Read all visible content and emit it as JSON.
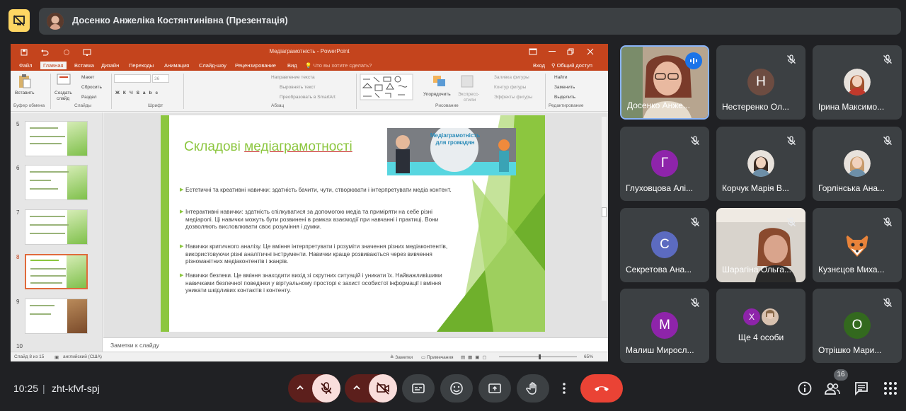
{
  "meeting": {
    "presenter_banner": "Досенко Анжеліка Костянтинівна (Презентація)",
    "time": "10:25",
    "separator": "|",
    "meeting_code": "zht-kfvf-spj",
    "participants_count": "16"
  },
  "powerpoint": {
    "window_title": "Медіаграмотність - PowerPoint",
    "tabs": [
      "Файл",
      "Главная",
      "Вставка",
      "Дизайн",
      "Переходы",
      "Анимация",
      "Слайд-шоу",
      "Рецензирование",
      "Вид"
    ],
    "tell_me": "Что вы хотите сделать?",
    "sign_in": "Вход",
    "share": "Общий доступ",
    "ribbon": {
      "paste": "Вставить",
      "new_slide_1": "Создать",
      "new_slide_2": "слайд",
      "layout": "Макет",
      "reset": "Сбросить",
      "section": "Раздел",
      "font_size": "36",
      "text_direction": "Направление текста",
      "align_text": "Выровнять текст",
      "smartart": "Преобразовать в SmartArt",
      "arrange": "Упорядочить",
      "quick_styles_1": "Экспресс-",
      "quick_styles_2": "стили",
      "shape_fill": "Заливка фигуры",
      "shape_outline": "Контур фигуры",
      "shape_effects": "Эффекты фигуры",
      "find": "Найти",
      "replace": "Заменить",
      "select": "Выделить",
      "groups": [
        "Буфер обмена",
        "Слайды",
        "Шрифт",
        "Абзац",
        "Рисование",
        "Редактирование"
      ]
    },
    "thumb_numbers": [
      "5",
      "6",
      "7",
      "8",
      "9",
      "10"
    ],
    "slide": {
      "title_plain": "Складові ",
      "title_underlined": "медіаграмотності",
      "image_caption": "Медіаграмотність для громадян",
      "bullets": [
        "Естетичні та креативні навички: здатність бачити, чути, створювати і інтерпретувати медіа контент.",
        "Інтерактивні навички: здатність спілкуватися за допомогою медіа та приміряти на себе різні медіаролі. Ці навички можуть бути розвинені в рамках взаємодії при навчанні і практиці. Вони дозволяють висловлювати своє розуміння і думки.",
        "Навички критичного аналізу. Це вміння інтерпретувати і розуміти значення різних медіаконтентів, використовуючи різні аналітичні інструменти. Навички краще розвиваються через вивчення різноманітних медіаконтентів і жанрів.",
        "Навички безпеки. Це вміння знаходити вихід зі скрутних ситуацій і уникати їх. Найважливішими навичками безпечної поведінки у віртуальному просторі є захист особистої інформації і вміння уникати шкідливих контактів і контенту."
      ]
    },
    "notes_placeholder": "Заметки к слайду",
    "status": {
      "slide_of": "Слайд 8 из 15",
      "language": "английский (США)",
      "notes": "Заметки",
      "comments": "Примечания",
      "zoom": "65%"
    }
  },
  "participants": [
    {
      "name": "Досенко Анже...",
      "initial": "",
      "type": "video-speaking"
    },
    {
      "name": "Нестеренко Ол...",
      "initial": "Н",
      "color": "#6d4c41"
    },
    {
      "name": "Ірина Максимо...",
      "initial": "",
      "type": "photo"
    },
    {
      "name": "Глуховцова Алі...",
      "initial": "Г",
      "color": "#8e24aa"
    },
    {
      "name": "Корчук Марія В...",
      "initial": "",
      "type": "photo"
    },
    {
      "name": "Горлінська Ана...",
      "initial": "",
      "type": "photo"
    },
    {
      "name": "Секретова Ана...",
      "initial": "С",
      "color": "#5c6bc0"
    },
    {
      "name": "Шарагіна Ольга...",
      "initial": "",
      "type": "video"
    },
    {
      "name": "Кузнєцов Миха...",
      "initial": "",
      "type": "fox"
    },
    {
      "name": "Малиш Миросл...",
      "initial": "М",
      "color": "#8e24aa"
    },
    {
      "name": "Ще 4 особи",
      "initial": "Х",
      "color": "#8e24aa",
      "type": "more"
    },
    {
      "name": "Отрішко Мари...",
      "initial": "О",
      "color": "#33691e"
    }
  ],
  "colors": {
    "accent_green": "#8cc63f",
    "ppt_orange": "#c4441d",
    "end_call": "#ea4335",
    "muted_bg": "#f9dedc"
  }
}
